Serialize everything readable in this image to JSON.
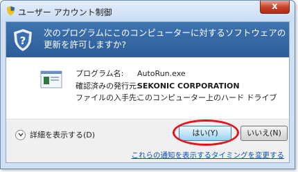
{
  "window": {
    "title": "ユーザー アカウント制御",
    "close_label": "x"
  },
  "banner": {
    "message": "次のプログラムにこのコンピューターに対するソフトウェアの更新を許可しますか?"
  },
  "details": {
    "program_label": "プログラム名:",
    "program_value": "AutoRun.exe",
    "publisher_label": "確認済みの発行元:",
    "publisher_value": "SEKONIC CORPORATION",
    "source_label": "ファイルの入手先:",
    "source_value": "このコンピューター上のハード ドライブ"
  },
  "footer": {
    "details_toggle": "詳細を表示する(D)",
    "yes_button": "はい(Y)",
    "no_button": "いいえ(N)",
    "notify_link": "これらの通知を表示するタイミングを変更する"
  },
  "colors": {
    "banner": "#2f62a0",
    "highlight": "#e4141b",
    "link": "#0c4eb6"
  }
}
